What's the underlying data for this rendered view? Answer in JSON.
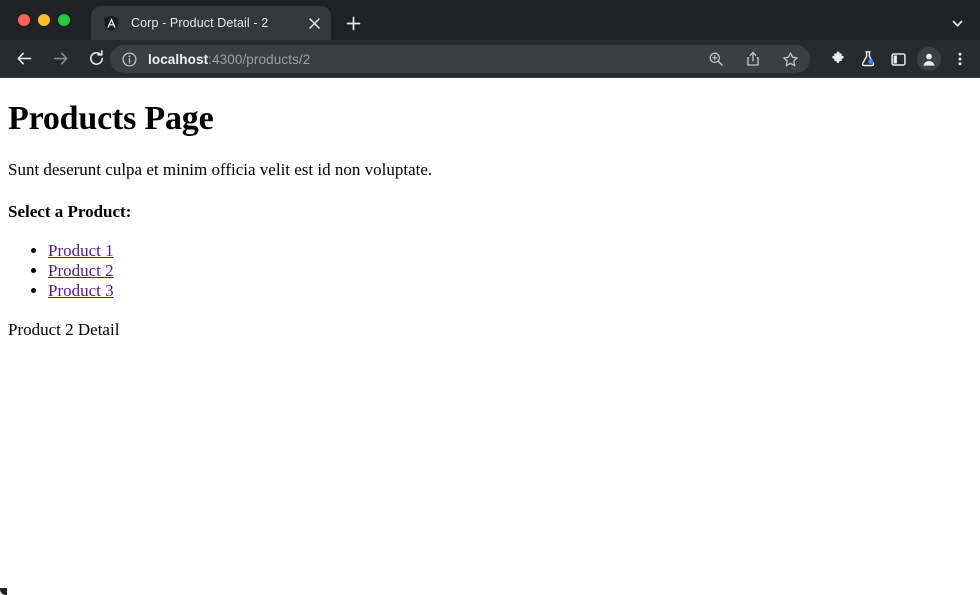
{
  "window": {
    "traffic_lights": [
      {
        "name": "close-window-button",
        "color": "#ff5f57"
      },
      {
        "name": "minimize-window-button",
        "color": "#febc2e"
      },
      {
        "name": "maximize-window-button",
        "color": "#28c840"
      }
    ]
  },
  "tab_strip": {
    "tabs": [
      {
        "title": "Corp - Product Detail - 2",
        "favicon": "angular-shield-icon",
        "active": true,
        "close_icon": "close-icon"
      }
    ],
    "new_tab_icon": "plus-icon",
    "tab_list_icon": "chevron-down-icon"
  },
  "toolbar": {
    "back_icon": "back-arrow-icon",
    "forward_icon": "forward-arrow-icon",
    "reload_icon": "reload-icon",
    "omnibox": {
      "site_info_icon": "info-circle-icon",
      "url_host": "localhost",
      "url_rest": ":4300/products/2",
      "url_full": "localhost:4300/products/2",
      "actions": [
        {
          "name": "zoom-indicator-icon",
          "label": "zoom-in-magnifier"
        },
        {
          "name": "share-icon",
          "label": "share"
        },
        {
          "name": "bookmark-star-icon",
          "label": "bookmark"
        }
      ]
    },
    "right_actions": [
      {
        "name": "extensions-puzzle-icon",
        "label": "extensions"
      },
      {
        "name": "chrome-labs-flask-icon",
        "label": "chrome-labs"
      },
      {
        "name": "side-panel-icon",
        "label": "side-panel"
      },
      {
        "name": "profile-avatar",
        "label": "profile"
      },
      {
        "name": "more-menu-icon",
        "label": "customize-and-control"
      }
    ]
  },
  "page": {
    "title": "Products Page",
    "intro": "Sunt deserunt culpa et minim officia velit est id non voluptate.",
    "section_label": "Select a Product:",
    "products": [
      {
        "label": "Product 1"
      },
      {
        "label": "Product 2"
      },
      {
        "label": "Product 3"
      }
    ],
    "detail": "Product 2 Detail",
    "link_color": "#551a8b"
  }
}
